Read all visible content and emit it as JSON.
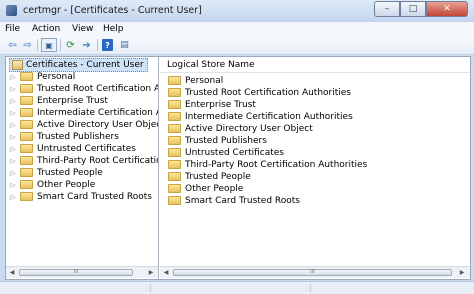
{
  "window": {
    "title": "certmgr - [Certificates - Current User]",
    "buttons": {
      "minimize": "–",
      "maximize": "□",
      "close": "✕"
    }
  },
  "menu": [
    "File",
    "Action",
    "View",
    "Help"
  ],
  "toolbar": {
    "back": "⇦",
    "forward": "⇨",
    "console": "▣",
    "refresh": "⟳",
    "export": "➔",
    "help": "?",
    "properties": "▤"
  },
  "tree": {
    "root": "Certificates - Current User",
    "items": [
      "Personal",
      "Trusted Root Certification Au",
      "Enterprise Trust",
      "Intermediate Certification Au",
      "Active Directory User Object",
      "Trusted Publishers",
      "Untrusted Certificates",
      "Third-Party Root Certification",
      "Trusted People",
      "Other People",
      "Smart Card Trusted Roots"
    ],
    "expander": "▷",
    "scroll": {
      "left": "◀",
      "right": "▶",
      "grip": "III"
    }
  },
  "list": {
    "column": "Logical Store Name",
    "items": [
      "Personal",
      "Trusted Root Certification Authorities",
      "Enterprise Trust",
      "Intermediate Certification Authorities",
      "Active Directory User Object",
      "Trusted Publishers",
      "Untrusted Certificates",
      "Third-Party Root Certification Authorities",
      "Trusted People",
      "Other People",
      "Smart Card Trusted Roots"
    ],
    "scroll": {
      "left": "◀",
      "right": "▶",
      "grip": "III"
    }
  }
}
